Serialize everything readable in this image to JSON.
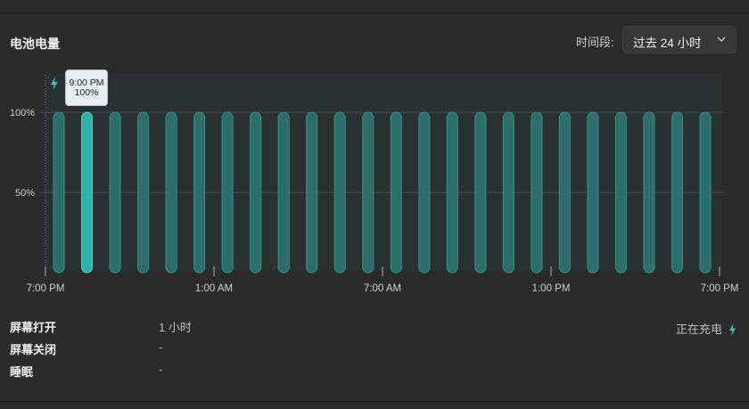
{
  "header": {
    "title": "电池电量",
    "period_label": "时间段:",
    "period_value": "过去 24 小时",
    "period_chevron_icon": "chevron-down-icon"
  },
  "tooltip": {
    "time": "9:00 PM",
    "value": "100%"
  },
  "stats": [
    {
      "label": "屏幕打开",
      "value": "1 小时"
    },
    {
      "label": "屏幕关闭",
      "value": "-"
    },
    {
      "label": "睡眠",
      "value": "-"
    }
  ],
  "status": {
    "text": "正在充电",
    "icon": "lightning-icon"
  },
  "colors": {
    "bar": "#2c6e6c",
    "bar_highlight": "#2bb3ad",
    "background": "#2b2b2b"
  },
  "chart_data": {
    "type": "bar",
    "x_tick_labels": [
      "7:00 PM",
      "1:00 AM",
      "7:00 AM",
      "1:00 PM",
      "7:00 PM"
    ],
    "y_tick_labels": [
      "100%",
      "50%"
    ],
    "ylim": [
      0,
      100
    ],
    "values": [
      100,
      100,
      100,
      100,
      100,
      100,
      100,
      100,
      100,
      100,
      100,
      100,
      100,
      100,
      100,
      100,
      100,
      100,
      100,
      100,
      100,
      100,
      100,
      100
    ],
    "highlighted_index": 1,
    "charging_marker": "lightning-icon"
  }
}
